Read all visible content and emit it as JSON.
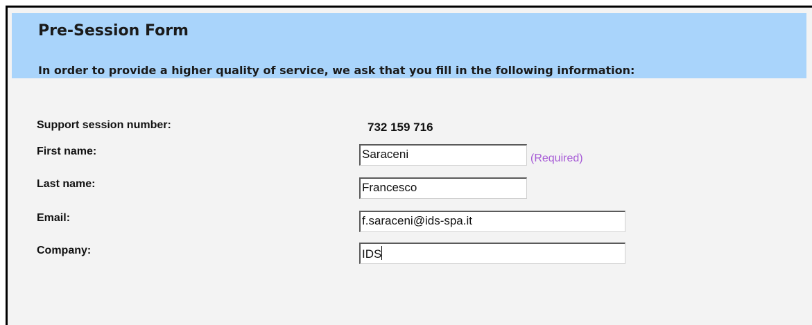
{
  "form": {
    "title": "Pre-Session Form",
    "intro": "In order to provide a higher quality of service, we ask that you fill in the following information:",
    "session": {
      "label": "Support session number:",
      "value": "732 159 716"
    },
    "first_name": {
      "label": "First name:",
      "value": "Saraceni",
      "hint": "(Required)"
    },
    "last_name": {
      "label": "Last name:",
      "value": "Francesco"
    },
    "email": {
      "label": "Email:",
      "value": "f.saraceni@ids-spa.it"
    },
    "company": {
      "label": "Company:",
      "value": "IDS"
    }
  },
  "colors": {
    "header_background": "#a9d4fb",
    "page_background": "#f3f3f3",
    "required_hint": "#a65ad6"
  }
}
